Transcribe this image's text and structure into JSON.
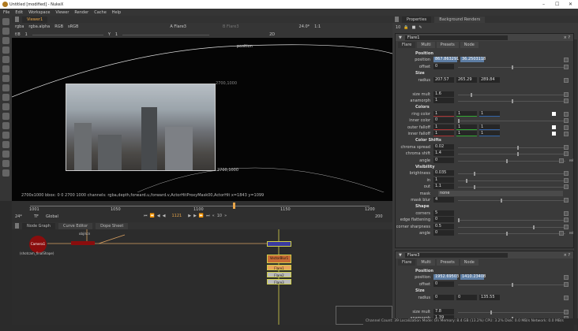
{
  "window": {
    "title": "Untitled [modified] - NukeX",
    "min": "–",
    "max": "☐",
    "close": "✕"
  },
  "menu": [
    "File",
    "Edit",
    "Workspace",
    "Viewer",
    "Render",
    "Cache",
    "Help"
  ],
  "viewer": {
    "tab": "Viewer1",
    "channels": "rgba",
    "alpha": "rgba.alpha",
    "display": "RGB",
    "lut": "sRGB",
    "input_a": "A  Flare3",
    "input_b": "B  Flare3",
    "fstop": "f/8",
    "frame_gain": "1",
    "gamma_label": "Y",
    "gamma": "1",
    "fps": "24.0*",
    "scale": "1:1",
    "mode": "2D",
    "labels": {
      "position": "position",
      "corner": "2700,1000",
      "corner2": "2700,1000"
    },
    "info": "2700x1000  bbox: 0 0 2700 1000 channels: rgba,depth,forward.u,forward.v,ActorHitProxyMask00,ActorHit  x=1843 y=1099"
  },
  "timeline": {
    "start": "1001",
    "end": "1200",
    "ticks": [
      "1001",
      "1050",
      "1100",
      "1150",
      "1200"
    ],
    "current": "1121",
    "fps": "24*",
    "tf": "TF",
    "scope": "Global",
    "step": "10",
    "end_field": "200",
    "playhead_fraction": 0.6
  },
  "nodegraph": {
    "tabs": [
      "Node Graph",
      "Curve Editor",
      "Dope Sheet"
    ],
    "camera": "Camera1",
    "camera_sub": "(shotcam_finalShape)",
    "nodes": [
      "VectorBlur1",
      "Flare1",
      "Flare2",
      "Flare3"
    ],
    "label_obj": "obj/scn",
    "label_cam": "cam",
    "label_img": "img"
  },
  "properties": {
    "tabs": [
      "Properties",
      "Background Renders"
    ],
    "count": "10",
    "flare1": {
      "name": "Flare1",
      "tabs": [
        "Flare",
        "Multi",
        "Presets",
        "Node"
      ],
      "rows": [
        {
          "h": "Position"
        },
        {
          "l": "position",
          "x": "867.863291",
          "y": "36.2503118",
          "sel": true
        },
        {
          "l": "offset",
          "v": "0",
          "k": 0.5
        },
        {
          "h": "Size"
        },
        {
          "l": "radius",
          "v3": [
            "207.57",
            "265.29",
            "289.84"
          ]
        },
        {
          "l": "size mult",
          "v": "1.6",
          "k": 0.12
        },
        {
          "l": "anamorph",
          "v": "1",
          "k": 0.5
        },
        {
          "h": "Colors"
        },
        {
          "l": "ring color",
          "c3": [
            "1",
            "1",
            "1"
          ]
        },
        {
          "l": "inner color",
          "v": "0",
          "k": 0
        },
        {
          "l": "outer falloff",
          "c3": [
            "1",
            "1",
            "1"
          ]
        },
        {
          "l": "inner falloff",
          "c3": [
            "1",
            "1",
            "1"
          ]
        },
        {
          "h": "Color Shifts"
        },
        {
          "l": "chroma spread",
          "v": "0.02",
          "k": 0.55
        },
        {
          "l": "chroma shift",
          "v": "1.4",
          "k": 0.55
        },
        {
          "l": "angle",
          "v": "0",
          "k": 0.45,
          "rel": "rel"
        },
        {
          "h": "Visibility"
        },
        {
          "l": "brightness",
          "v": "0.035",
          "k": 0.15
        },
        {
          "l": "in",
          "v": "1",
          "k": 0.07
        },
        {
          "l": "out",
          "v": "1.1",
          "k": 0.15
        },
        {
          "l": "mask",
          "menu": "none"
        },
        {
          "l": "mask blur",
          "v": "4",
          "k": 0.4
        },
        {
          "h": "Shape"
        },
        {
          "l": "corners",
          "v": "5"
        },
        {
          "l": "edge flattening",
          "v": "0",
          "k": 0
        },
        {
          "l": "corner sharpness",
          "v": "0.5",
          "k": 0.7
        },
        {
          "l": "angle",
          "v": "0",
          "k": 0.45,
          "rel": "rel"
        }
      ]
    },
    "flare3": {
      "name": "Flare3",
      "tabs": [
        "Flare",
        "Multi",
        "Presets",
        "Node"
      ],
      "rows": [
        {
          "h": "Position"
        },
        {
          "l": "position",
          "x": "1952.69503",
          "y": "1410.23408",
          "sel": true
        },
        {
          "l": "offset",
          "v": "0",
          "k": 0.5
        },
        {
          "h": "Size"
        },
        {
          "l": "radius",
          "v3": [
            "0",
            "0",
            "135.55"
          ]
        },
        {
          "l": "size mult",
          "v": "7.8",
          "k": 0.3
        },
        {
          "l": "anamorph",
          "v": "1.39",
          "k": 0.5
        }
      ]
    }
  },
  "status": "Channel Count: 39  Localization Mode: On  Memory: 8.4 GB (13.2%)  CPU: 3.2%  Disk: 0.0 MB/s  Network: 0.0 MB/s",
  "colors": {
    "accent": "#e8a64a",
    "selection": "#5d7da3",
    "node_red": "#8a0d0d"
  }
}
